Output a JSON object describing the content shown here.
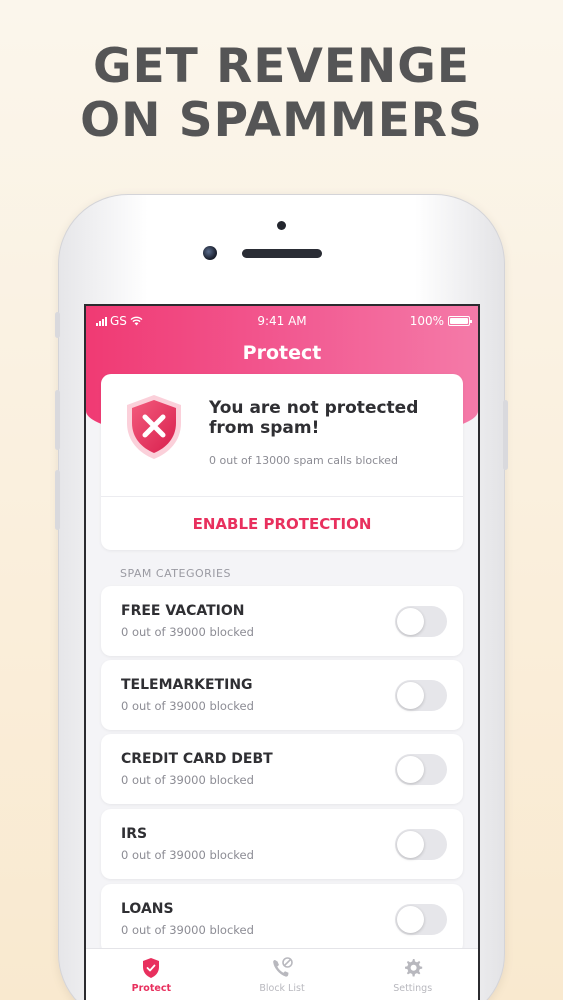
{
  "headline": {
    "line1": "GET REVENGE",
    "line2": "ON SPAMMERS"
  },
  "status_bar": {
    "carrier": "GS",
    "time": "9:41 AM",
    "battery": "100%"
  },
  "screen": {
    "title": "Protect"
  },
  "protection_card": {
    "icon": "shield-x-icon",
    "title": "You are not protected from spam!",
    "subtitle": "0 out of 13000 spam calls blocked",
    "button_label": "ENABLE PROTECTION"
  },
  "categories": {
    "section_label": "SPAM CATEGORIES",
    "items": [
      {
        "title": "FREE VACATION",
        "subtitle": "0 out of 39000 blocked",
        "enabled": false
      },
      {
        "title": "TELEMARKETING",
        "subtitle": "0 out of 39000 blocked",
        "enabled": false
      },
      {
        "title": "CREDIT CARD DEBT",
        "subtitle": "0 out of 39000 blocked",
        "enabled": false
      },
      {
        "title": "IRS",
        "subtitle": "0 out of 39000 blocked",
        "enabled": false
      },
      {
        "title": "LOANS",
        "subtitle": "0 out of 39000 blocked",
        "enabled": false
      }
    ]
  },
  "tabs": [
    {
      "label": "Protect",
      "icon": "shield-icon",
      "active": true
    },
    {
      "label": "Block List",
      "icon": "blocked-phone-icon",
      "active": false
    },
    {
      "label": "Settings",
      "icon": "gear-icon",
      "active": false
    }
  ],
  "colors": {
    "accent": "#e8305e",
    "header_gradient_start": "#f03a73",
    "header_gradient_end": "#f47aa8",
    "headline": "#555556"
  }
}
